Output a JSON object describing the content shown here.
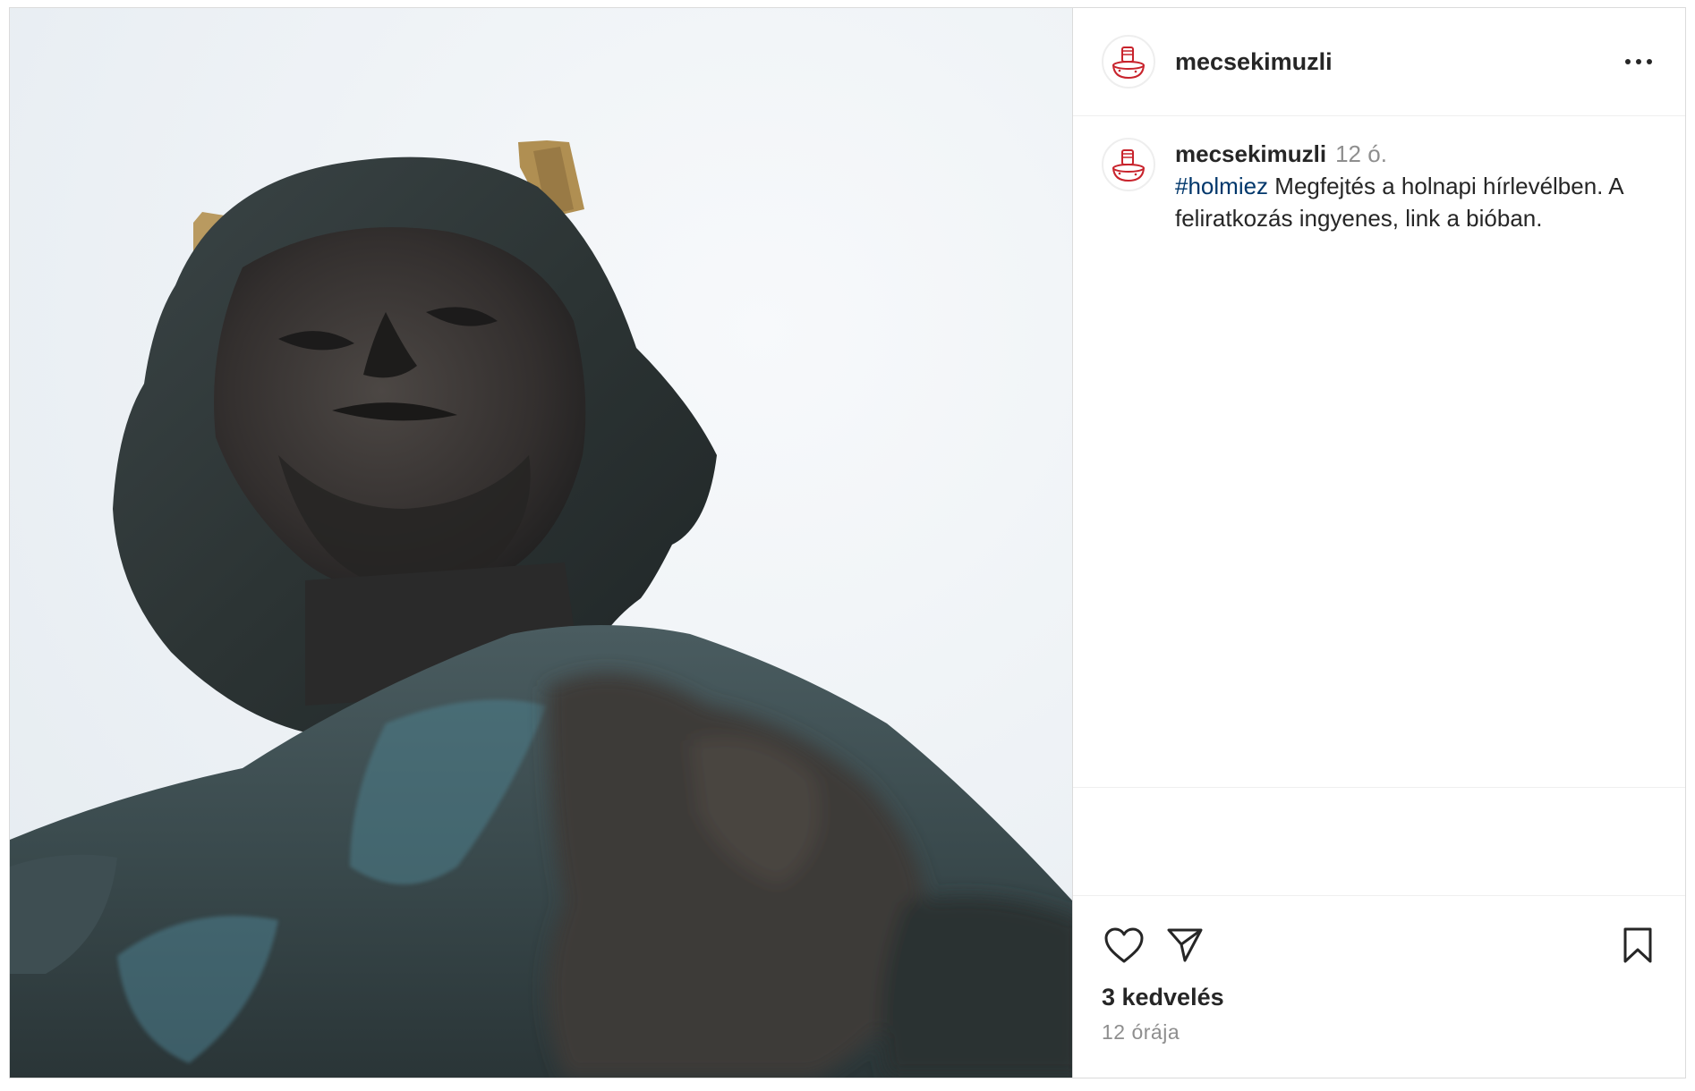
{
  "post": {
    "image_alt": "Bronze statue of a horned bearded figure against a pale sky",
    "header": {
      "username": "mecsekimuzli",
      "more_icon": "more-horizontal-icon"
    },
    "caption": {
      "username": "mecsekimuzli",
      "time_ago": "12 ó.",
      "hashtag": "#holmiez",
      "text": " Megfejtés a holnapi hírlevélben. A feliratkozás ingyenes, link a bióban."
    },
    "actions": {
      "like_icon": "heart-icon",
      "share_icon": "send-icon",
      "save_icon": "bookmark-icon"
    },
    "likes_text": "3 kedvelés",
    "date_text": "12 órája",
    "colors": {
      "border": "#dbdbdb",
      "text": "#262626",
      "secondary": "#8e8e8e",
      "hashtag": "#00376b",
      "avatar_red": "#c8232c"
    }
  }
}
